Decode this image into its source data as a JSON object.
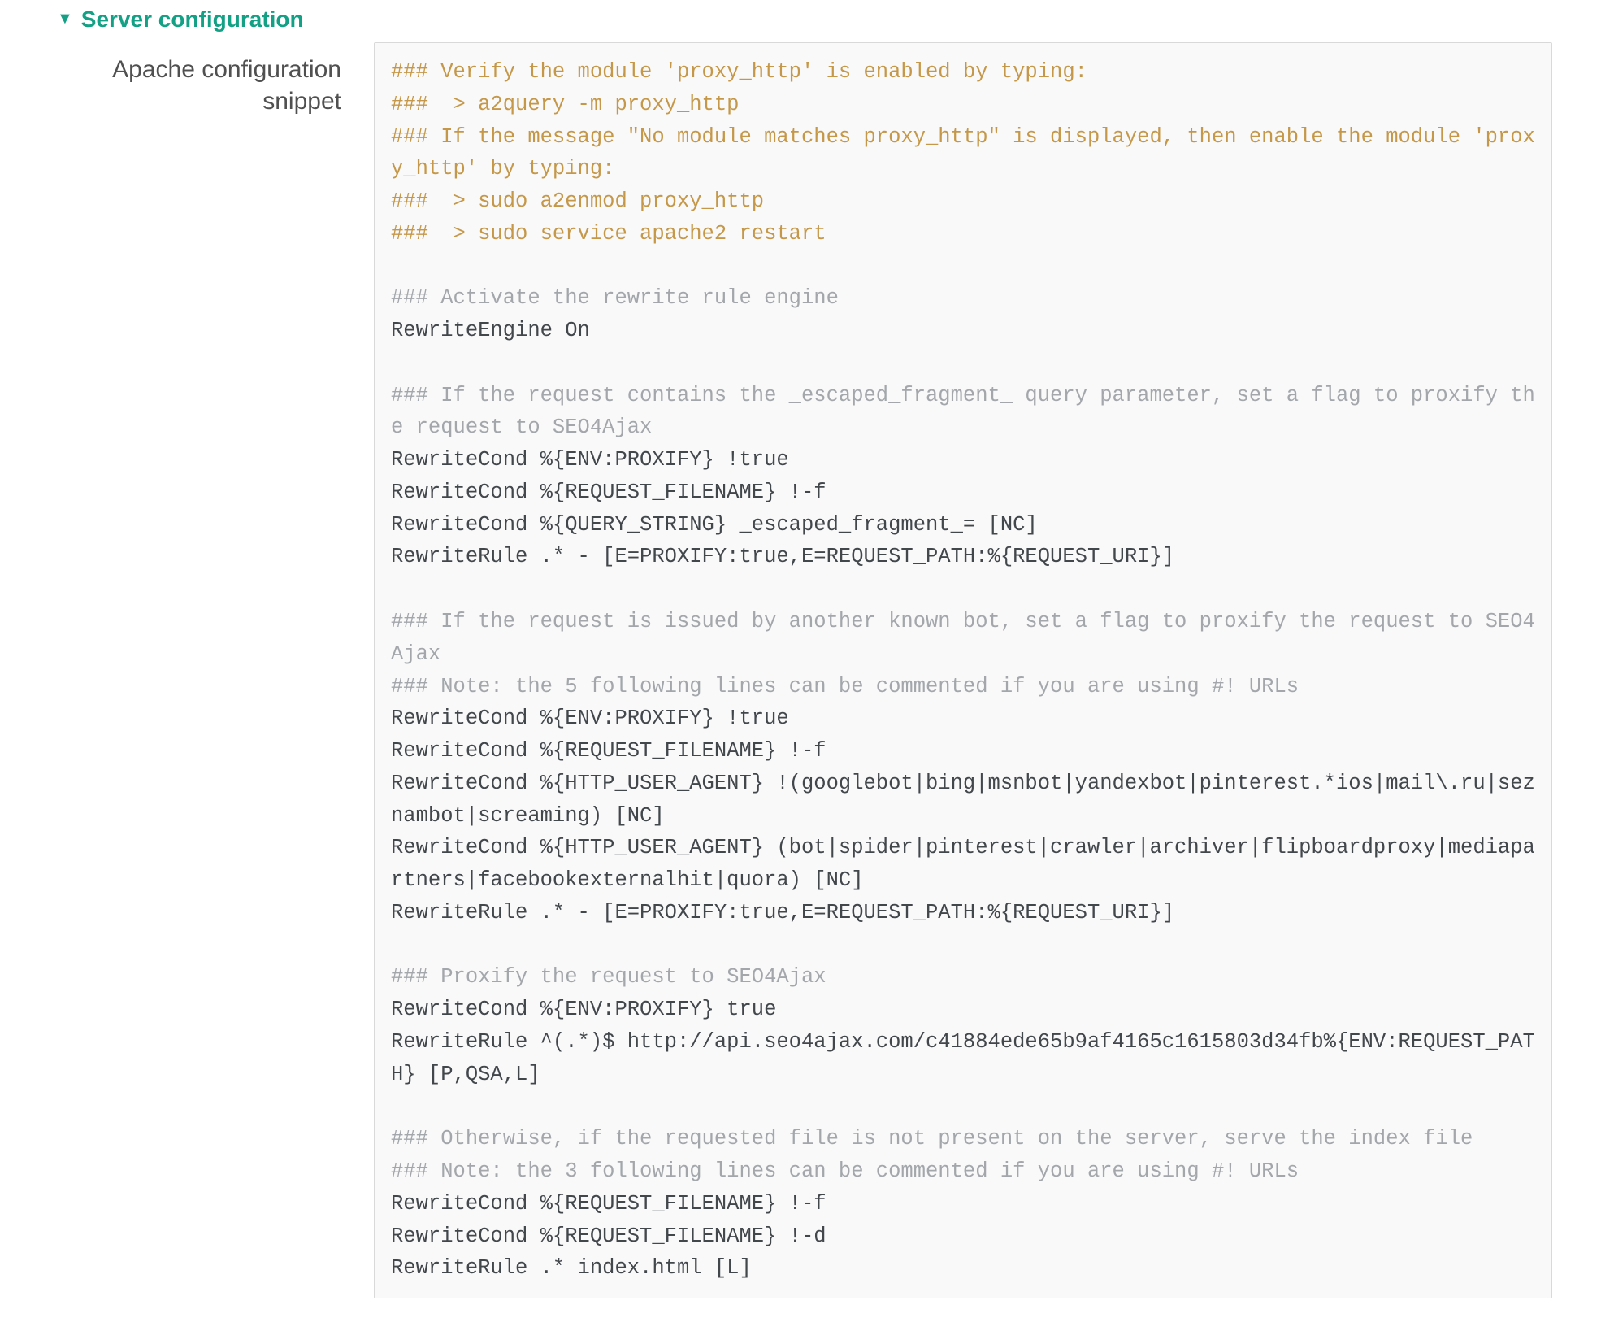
{
  "section": {
    "title": "Server configuration",
    "expanded": true
  },
  "field": {
    "label": "Apache configuration snippet"
  },
  "code": {
    "lines": [
      {
        "cls": "tok-comment",
        "text": "### Verify the module 'proxy_http' is enabled by typing:"
      },
      {
        "cls": "tok-comment",
        "text": "###  > a2query -m proxy_http"
      },
      {
        "cls": "tok-comment",
        "text": "### If the message \"No module matches proxy_http\" is displayed, then enable the module 'proxy_http' by typing:"
      },
      {
        "cls": "tok-comment",
        "text": "###  > sudo a2enmod proxy_http"
      },
      {
        "cls": "tok-comment",
        "text": "###  > sudo service apache2 restart"
      },
      {
        "cls": "blank",
        "text": ""
      },
      {
        "cls": "tok-grey",
        "text": "### Activate the rewrite rule engine"
      },
      {
        "cls": "tok-code",
        "text": "RewriteEngine On"
      },
      {
        "cls": "blank",
        "text": ""
      },
      {
        "cls": "tok-grey",
        "text": "### If the request contains the _escaped_fragment_ query parameter, set a flag to proxify the request to SEO4Ajax"
      },
      {
        "cls": "tok-code",
        "text": "RewriteCond %{ENV:PROXIFY} !true"
      },
      {
        "cls": "tok-code",
        "text": "RewriteCond %{REQUEST_FILENAME} !-f"
      },
      {
        "cls": "tok-code",
        "text": "RewriteCond %{QUERY_STRING} _escaped_fragment_= [NC]"
      },
      {
        "cls": "tok-code",
        "text": "RewriteRule .* - [E=PROXIFY:true,E=REQUEST_PATH:%{REQUEST_URI}]"
      },
      {
        "cls": "blank",
        "text": ""
      },
      {
        "cls": "tok-grey",
        "text": "### If the request is issued by another known bot, set a flag to proxify the request to SEO4Ajax"
      },
      {
        "cls": "tok-grey",
        "text": "### Note: the 5 following lines can be commented if you are using #! URLs"
      },
      {
        "cls": "tok-code",
        "text": "RewriteCond %{ENV:PROXIFY} !true"
      },
      {
        "cls": "tok-code",
        "text": "RewriteCond %{REQUEST_FILENAME} !-f"
      },
      {
        "cls": "tok-code",
        "text": "RewriteCond %{HTTP_USER_AGENT} !(googlebot|bing|msnbot|yandexbot|pinterest.*ios|mail\\.ru|seznambot|screaming) [NC]"
      },
      {
        "cls": "tok-code",
        "text": "RewriteCond %{HTTP_USER_AGENT} (bot|spider|pinterest|crawler|archiver|flipboardproxy|mediapartners|facebookexternalhit|quora) [NC]"
      },
      {
        "cls": "tok-code",
        "text": "RewriteRule .* - [E=PROXIFY:true,E=REQUEST_PATH:%{REQUEST_URI}]"
      },
      {
        "cls": "blank",
        "text": ""
      },
      {
        "cls": "tok-grey",
        "text": "### Proxify the request to SEO4Ajax"
      },
      {
        "cls": "tok-code",
        "text": "RewriteCond %{ENV:PROXIFY} true"
      },
      {
        "cls": "tok-code",
        "text": "RewriteRule ^(.*)$ http://api.seo4ajax.com/c41884ede65b9af4165c1615803d34fb%{ENV:REQUEST_PATH} [P,QSA,L]"
      },
      {
        "cls": "blank",
        "text": ""
      },
      {
        "cls": "tok-grey",
        "text": "### Otherwise, if the requested file is not present on the server, serve the index file"
      },
      {
        "cls": "tok-grey",
        "text": "### Note: the 3 following lines can be commented if you are using #! URLs"
      },
      {
        "cls": "tok-code",
        "text": "RewriteCond %{REQUEST_FILENAME} !-f"
      },
      {
        "cls": "tok-code",
        "text": "RewriteCond %{REQUEST_FILENAME} !-d"
      },
      {
        "cls": "tok-code",
        "text": "RewriteRule .* index.html [L]"
      }
    ]
  }
}
